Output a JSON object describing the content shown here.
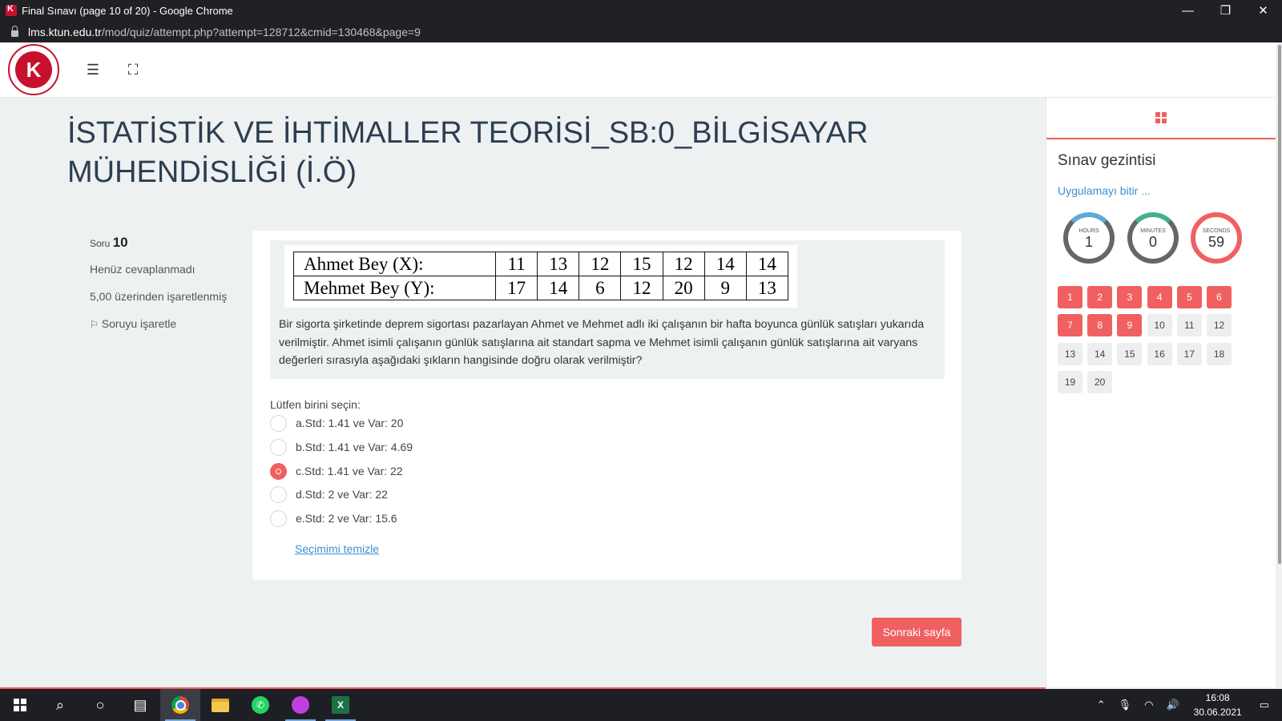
{
  "browser": {
    "window_title": "Final Sınavı (page 10 of 20) - Google Chrome",
    "url_host": "lms.ktun.edu.tr",
    "url_path": "/mod/quiz/attempt.php?attempt=128712&cmid=130468&page=9",
    "controls": {
      "minimize": "—",
      "restore": "❐",
      "close": "✕"
    }
  },
  "header": {
    "logo_letter": "K",
    "menu_icon": "☰",
    "fullscreen_icon": "⛶"
  },
  "page": {
    "title": "İSTATİSTİK VE İHTİMALLER TEORİSİ_SB:0_BİLGİSAYAR MÜHENDİSLİĞİ (İ.Ö)"
  },
  "question_info": {
    "label": "Soru",
    "number": "10",
    "status": "Henüz cevaplanmadı",
    "marks": "5,00 üzerinden işaretlenmiş",
    "flag_label": "Soruyu işaretle"
  },
  "question": {
    "table": [
      {
        "label": "Ahmet Bey (X):",
        "values": [
          "11",
          "13",
          "12",
          "15",
          "12",
          "14",
          "14"
        ]
      },
      {
        "label": "Mehmet Bey (Y):",
        "values": [
          "17",
          "14",
          "6",
          "12",
          "20",
          "9",
          "13"
        ]
      }
    ],
    "text": "Bir sigorta şirketinde deprem sigortası pazarlayan Ahmet ve Mehmet adlı iki çalışanın bir hafta boyunca günlük satışları yukarıda verilmiştir. Ahmet isimli çalışanın günlük satışlarına ait standart sapma ve Mehmet isimli çalışanın günlük satışlarına ait varyans değerleri sırasıyla aşağıdaki şıkların hangisinde doğru olarak verilmiştir?",
    "prompt": "Lütfen birini seçin:",
    "options": [
      {
        "label": "a.Std: 1.41 ve Var: 20",
        "selected": false
      },
      {
        "label": "b.Std: 1.41 ve Var: 4.69",
        "selected": false
      },
      {
        "label": "c.Std: 1.41 ve Var: 22",
        "selected": true
      },
      {
        "label": "d.Std: 2 ve Var: 22",
        "selected": false
      },
      {
        "label": "e.Std: 2 ve Var: 15.6",
        "selected": false
      }
    ],
    "clear_label": "Seçimimi temizle"
  },
  "next_button": "Sonraki sayfa",
  "drawer": {
    "title": "Sınav gezintisi",
    "finish_link": "Uygulamayı bitir ...",
    "timer": {
      "hours_label": "HOURS",
      "hours": "1",
      "minutes_label": "MINUTES",
      "minutes": "0",
      "seconds_label": "SECONDS",
      "seconds": "59"
    },
    "questions": [
      {
        "n": "1",
        "answered": true
      },
      {
        "n": "2",
        "answered": true
      },
      {
        "n": "3",
        "answered": true
      },
      {
        "n": "4",
        "answered": true
      },
      {
        "n": "5",
        "answered": true
      },
      {
        "n": "6",
        "answered": true
      },
      {
        "n": "7",
        "answered": true
      },
      {
        "n": "8",
        "answered": true
      },
      {
        "n": "9",
        "answered": true
      },
      {
        "n": "10",
        "answered": false
      },
      {
        "n": "11",
        "answered": false
      },
      {
        "n": "12",
        "answered": false
      },
      {
        "n": "13",
        "answered": false
      },
      {
        "n": "14",
        "answered": false
      },
      {
        "n": "15",
        "answered": false
      },
      {
        "n": "16",
        "answered": false
      },
      {
        "n": "17",
        "answered": false
      },
      {
        "n": "18",
        "answered": false
      },
      {
        "n": "19",
        "answered": false
      },
      {
        "n": "20",
        "answered": false
      }
    ]
  },
  "taskbar": {
    "time": "16:08",
    "date": "30.06.2021"
  },
  "colors": {
    "accent": "#f06060",
    "link": "#3b8fd4",
    "page_bg": "#eef1f2"
  }
}
